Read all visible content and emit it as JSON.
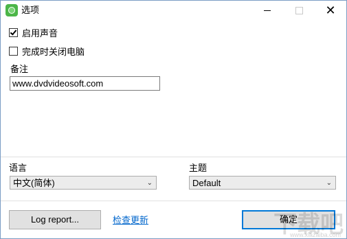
{
  "window": {
    "title": "选项",
    "accent_color": "#4cb648"
  },
  "options": {
    "enable_sound": {
      "label": "启用声音",
      "checked": true
    },
    "shutdown_when_done": {
      "label": "完成时关闭电脑",
      "checked": false
    }
  },
  "note": {
    "label": "备注",
    "value": "www.dvdvideosoft.com"
  },
  "language": {
    "label": "语言",
    "selected": "中文(简体)"
  },
  "theme": {
    "label": "主题",
    "selected": "Default"
  },
  "footer": {
    "log_report_label": "Log report...",
    "check_updates_label": "检查更新",
    "ok_label": "确定",
    "link_color": "#0066cc",
    "primary_border_color": "#0078d7"
  },
  "watermark": {
    "text": "下载吧",
    "sub": "www.xiazaiba.com"
  }
}
